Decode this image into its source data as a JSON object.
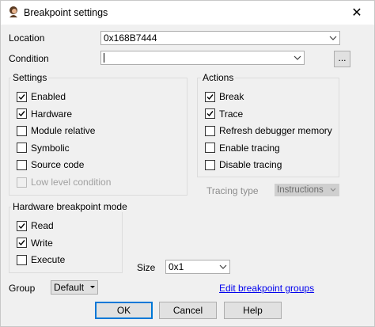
{
  "window": {
    "title": "Breakpoint settings",
    "close_glyph": "✕"
  },
  "location": {
    "label": "Location",
    "value": "0x168B7444"
  },
  "condition": {
    "label": "Condition",
    "value": "",
    "browse_label": "..."
  },
  "settings": {
    "title": "Settings",
    "items": [
      {
        "label": "Enabled",
        "checked": true,
        "enabled": true
      },
      {
        "label": "Hardware",
        "checked": true,
        "enabled": true
      },
      {
        "label": "Module relative",
        "checked": false,
        "enabled": true
      },
      {
        "label": "Symbolic",
        "checked": false,
        "enabled": true
      },
      {
        "label": "Source code",
        "checked": false,
        "enabled": true
      },
      {
        "label": "Low level condition",
        "checked": false,
        "enabled": false
      }
    ]
  },
  "actions": {
    "title": "Actions",
    "items": [
      {
        "label": "Break",
        "checked": true
      },
      {
        "label": "Trace",
        "checked": true
      },
      {
        "label": "Refresh debugger memory",
        "checked": false
      },
      {
        "label": "Enable tracing",
        "checked": false
      },
      {
        "label": "Disable tracing",
        "checked": false
      }
    ]
  },
  "tracing": {
    "label": "Tracing type",
    "value": "Instructions"
  },
  "hw_mode": {
    "title": "Hardware breakpoint mode",
    "items": [
      {
        "label": "Read",
        "checked": true
      },
      {
        "label": "Write",
        "checked": true
      },
      {
        "label": "Execute",
        "checked": false
      }
    ]
  },
  "size": {
    "label": "Size",
    "value": "0x1"
  },
  "group": {
    "label": "Group",
    "value": "Default",
    "edit_link": "Edit breakpoint groups"
  },
  "buttons": {
    "ok": "OK",
    "cancel": "Cancel",
    "help": "Help"
  },
  "colors": {
    "accent": "#0078d7",
    "link": "#0000ee"
  }
}
